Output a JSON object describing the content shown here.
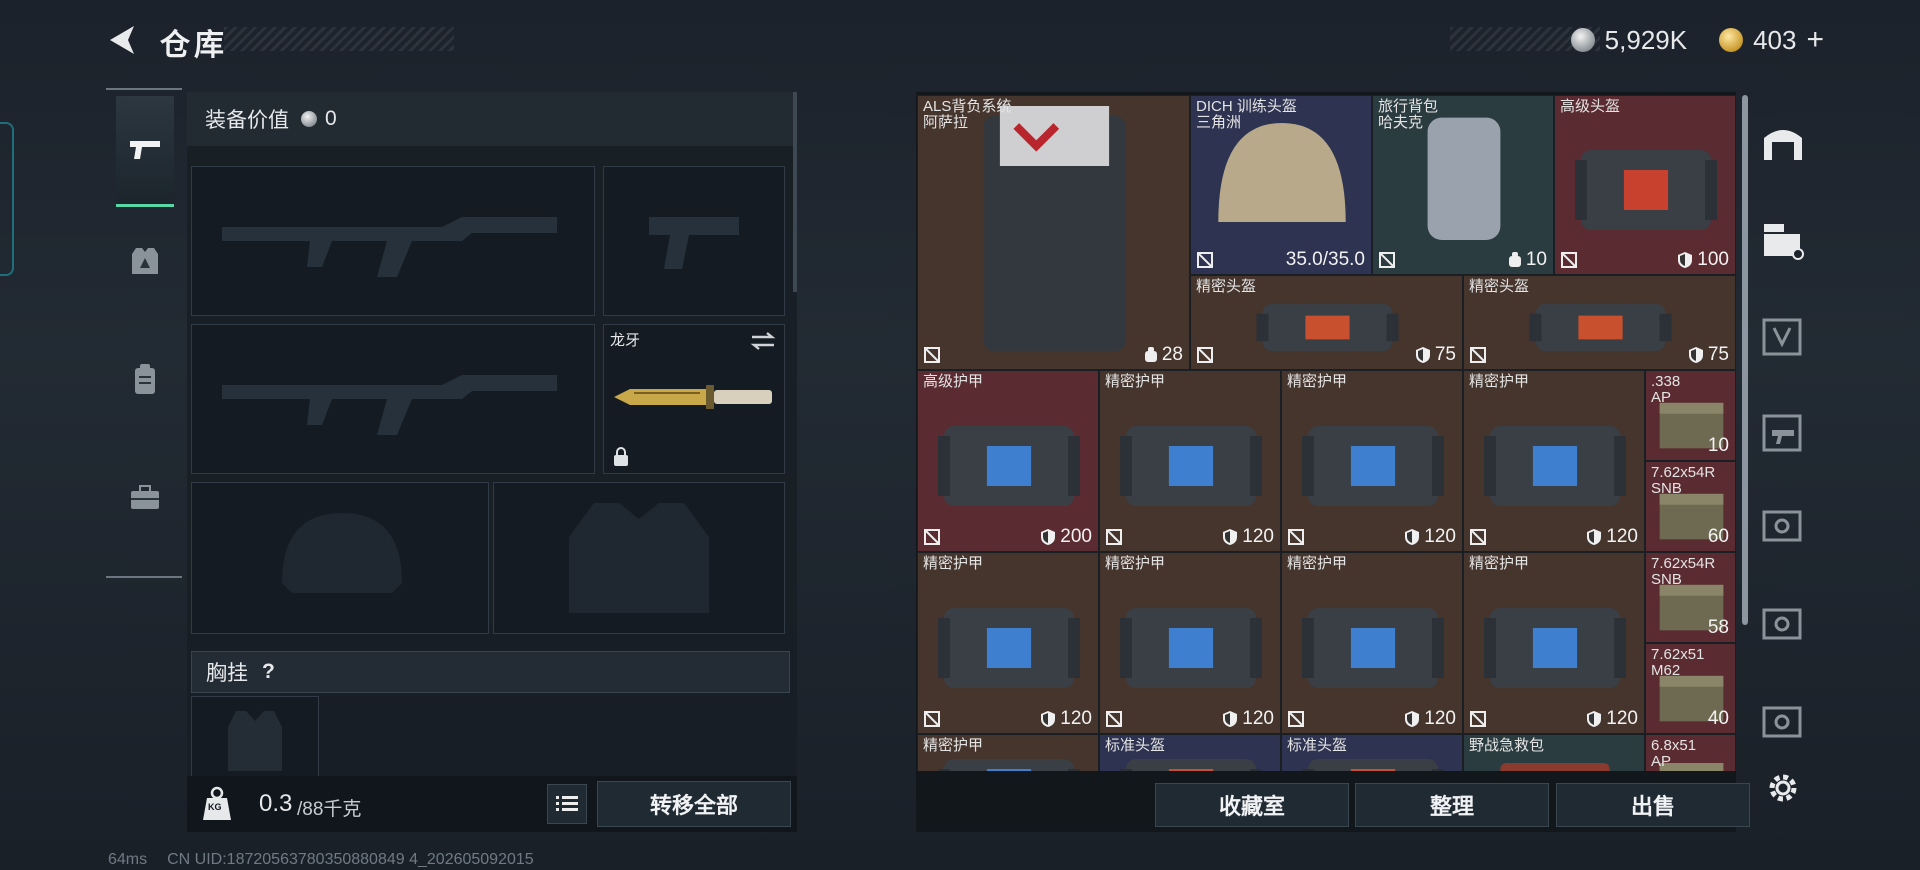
{
  "header": {
    "title": "仓库",
    "currency_silver": "5,929K",
    "currency_gold": "403",
    "add_symbol": "+"
  },
  "loadout": {
    "equip_value_label": "装备价值",
    "equip_value": "0",
    "knife_name": "龙牙",
    "chest_rig_label": "胸挂",
    "help_symbol": "?",
    "weight_value": "0.3",
    "weight_unit": "/88千克",
    "weight_icon_text": "KG",
    "transfer_all_label": "转移全部"
  },
  "storage": {
    "items": [
      {
        "name": "ALS背负系统\n阿萨拉",
        "value": "28",
        "icon": "capacity-icon",
        "color": "#45352d"
      },
      {
        "name": "DICH 训练头盔\n三角洲",
        "value": "35.0/35.0",
        "icon": "durability-text",
        "color": "#2d3350"
      },
      {
        "name": "旅行背包\n哈夫克",
        "value": "10",
        "icon": "capacity-icon",
        "color": "#2b3c40"
      },
      {
        "name": "高级头盔",
        "value": "100",
        "icon": "armor-shield-icon",
        "color": "#5a2b30"
      },
      {
        "name": "精密头盔",
        "value": "75",
        "icon": "armor-shield-icon",
        "color": "#45352d"
      },
      {
        "name": "精密头盔",
        "value": "75",
        "icon": "armor-shield-icon",
        "color": "#45352d"
      },
      {
        "name": "高级护甲",
        "value": "200",
        "icon": "armor-shield-icon",
        "color": "#5a2b30"
      },
      {
        "name": "精密护甲",
        "value": "120",
        "icon": "armor-shield-icon",
        "color": "#45352d"
      },
      {
        "name": "精密护甲",
        "value": "120",
        "icon": "armor-shield-icon",
        "color": "#45352d"
      },
      {
        "name": "精密护甲",
        "value": "120",
        "icon": "armor-shield-icon",
        "color": "#45352d"
      },
      {
        "name": "精密护甲",
        "value": "120",
        "icon": "armor-shield-icon",
        "color": "#45352d"
      },
      {
        "name": "精密护甲",
        "value": "120",
        "icon": "armor-shield-icon",
        "color": "#45352d"
      },
      {
        "name": "精密护甲",
        "value": "120",
        "icon": "armor-shield-icon",
        "color": "#45352d"
      },
      {
        "name": "精密护甲",
        "value": "120",
        "icon": "armor-shield-icon",
        "color": "#45352d"
      },
      {
        "name": ".338\nAP",
        "value": "10",
        "icon": "ammo",
        "color": "#5a2b30"
      },
      {
        "name": "7.62x54R\nSNB",
        "value": "60",
        "icon": "ammo",
        "color": "#5a2b30"
      },
      {
        "name": "7.62x54R\nSNB",
        "value": "58",
        "icon": "ammo",
        "color": "#5a2b30"
      },
      {
        "name": "7.62x51\nM62",
        "value": "40",
        "icon": "ammo",
        "color": "#5a2b30"
      },
      {
        "name": "精密护甲",
        "value": "",
        "icon": "armor-shield-icon",
        "color": "#45352d"
      },
      {
        "name": "标准头盔",
        "value": "",
        "icon": "armor-shield-icon",
        "color": "#2d3350"
      },
      {
        "name": "标准头盔",
        "value": "",
        "icon": "armor-shield-icon",
        "color": "#2d3350"
      },
      {
        "name": "野战急救包",
        "value": "",
        "icon": "medkit",
        "color": "#2b3c40"
      },
      {
        "name": "6.8x51\nAP",
        "value": "",
        "icon": "ammo",
        "color": "#5a2b30"
      }
    ],
    "collection_label": "收藏室",
    "sort_label": "整理",
    "sell_label": "出售"
  },
  "status": {
    "ping": "64ms",
    "uid": "CN UID:18720563780350880849 4_202605092015"
  }
}
